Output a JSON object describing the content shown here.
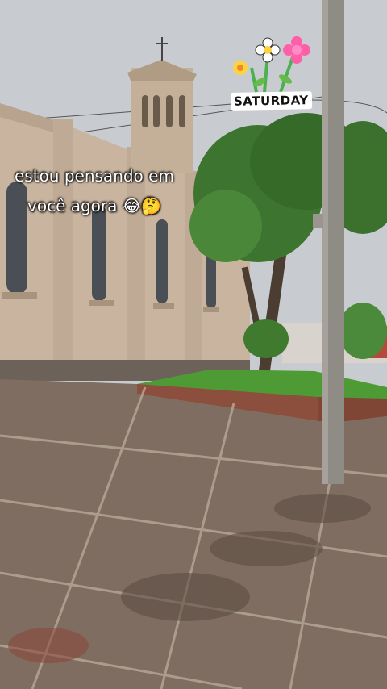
{
  "caption": {
    "line1": "estou pensando em",
    "line2": "você agora 😂🤔"
  },
  "sticker": {
    "label": "SATURDAY",
    "icon": "flowers-sticker-icon"
  },
  "colors": {
    "sky": "#c9cdd0",
    "church_wall": "#cbb7a0",
    "tree": "#3f7a2f",
    "grass": "#4e9a34",
    "pavement": "#7d6b5e",
    "pole": "#8e8a84"
  }
}
